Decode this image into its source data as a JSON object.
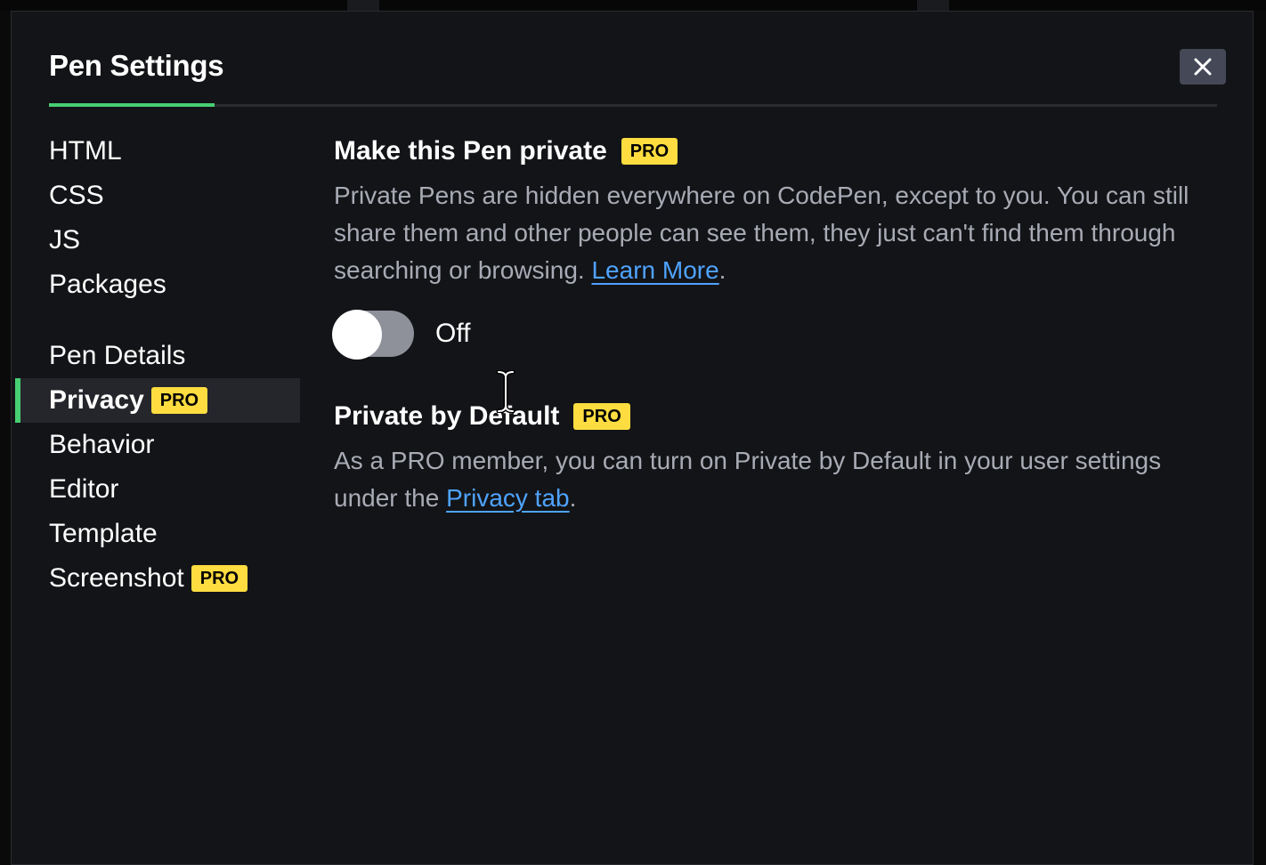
{
  "modal": {
    "title": "Pen Settings",
    "close_icon": "close-icon"
  },
  "sidebar": {
    "items": [
      {
        "label": "HTML"
      },
      {
        "label": "CSS"
      },
      {
        "label": "JS"
      },
      {
        "label": "Packages"
      },
      {
        "label": "Pen Details"
      },
      {
        "label": "Privacy",
        "badge": "PRO",
        "active": true
      },
      {
        "label": "Behavior"
      },
      {
        "label": "Editor"
      },
      {
        "label": "Template"
      },
      {
        "label": "Screenshot",
        "badge": "PRO"
      }
    ]
  },
  "privacy": {
    "heading": "Make this Pen private",
    "badge": "PRO",
    "description": "Private Pens are hidden everywhere on CodePen, except to you. You can still share them and other people can see them, they just can't find them through searching or browsing. ",
    "link_text": "Learn More",
    "link_suffix": ".",
    "toggle_state": "Off"
  },
  "private_default": {
    "heading": "Private by Default",
    "badge": "PRO",
    "description": "As a PRO member, you can turn on Private by Default in your user settings under the ",
    "link_text": "Privacy tab",
    "link_suffix": "."
  },
  "colors": {
    "accent": "#47cf73",
    "pro_badge": "#ffdd40",
    "link": "#4fa3ff",
    "background": "#131417"
  }
}
